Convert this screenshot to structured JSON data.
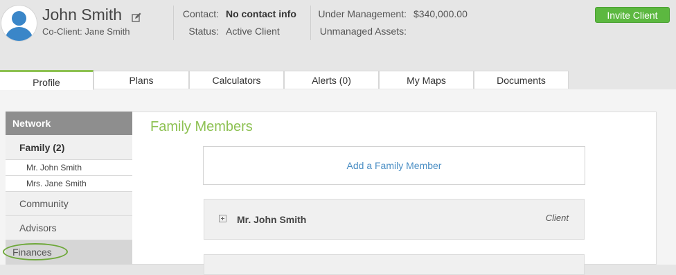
{
  "client": {
    "name": "John Smith",
    "co_client_label": "Co-Client:",
    "co_client_name": "Jane Smith"
  },
  "contact": {
    "contact_label": "Contact:",
    "contact_value": "No contact info",
    "status_label": "Status:",
    "status_value": "Active Client"
  },
  "assets": {
    "under_label": "Under Management:",
    "under_value": "$340,000.00",
    "unmanaged_label": "Unmanaged Assets:",
    "unmanaged_value": ""
  },
  "invite_button": "Invite Client",
  "tabs": [
    {
      "label": "Profile"
    },
    {
      "label": "Plans"
    },
    {
      "label": "Calculators"
    },
    {
      "label": "Alerts (0)"
    },
    {
      "label": "My Maps"
    },
    {
      "label": "Documents"
    }
  ],
  "sidebar": {
    "network": "Network",
    "family": "Family (2)",
    "members": [
      "Mr. John Smith",
      "Mrs. Jane Smith"
    ],
    "community": "Community",
    "advisors": "Advisors",
    "finances": "Finances"
  },
  "main": {
    "title": "Family Members",
    "add_link": "Add a Family Member",
    "members": [
      {
        "name": "Mr. John Smith",
        "role": "Client"
      }
    ]
  },
  "colors": {
    "accent_green": "#8dc152",
    "button_green": "#5cb840",
    "link_blue": "#4a8ec4",
    "avatar_blue": "#3a86c8"
  }
}
